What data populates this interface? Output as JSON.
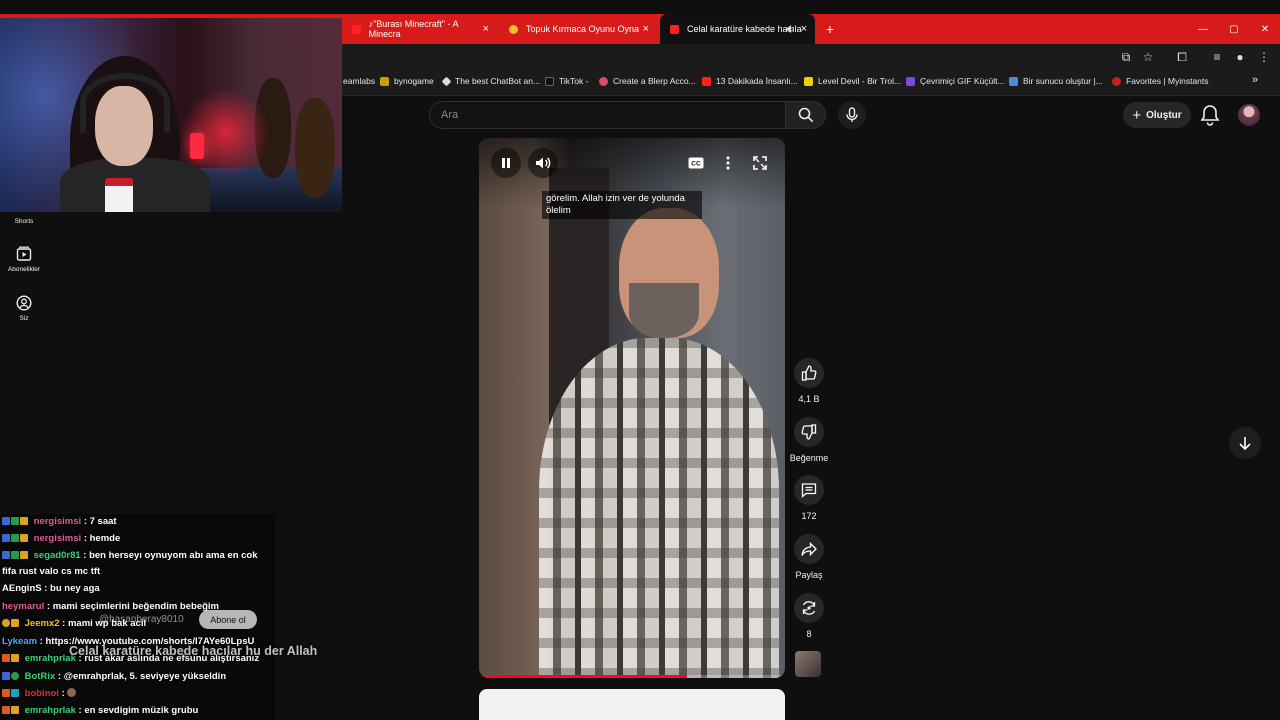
{
  "browser": {
    "tabs": [
      {
        "label": "♪\"Burası Minecraft\" - A Minecra",
        "close": "×"
      },
      {
        "label": "Topuk Kırmaca Oyunu Oyna",
        "close": "×"
      },
      {
        "label": "Celal karatüre kabede hacıla",
        "close": "×"
      }
    ],
    "new_tab": "+",
    "bookmarks": [
      "eamlabs",
      "bynogame",
      "The best ChatBot an...",
      "TikTok -",
      "Create a Blerp Acco...",
      "13 Dakikada İnsanlı...",
      "Level Devil - Bir Trol...",
      "Çevrimiçi GIF Küçült...",
      "Bir sunucu oluştur |...",
      "Favorites | Myinstants"
    ],
    "more_bookmarks": "»"
  },
  "youtube": {
    "search_placeholder": "Ara",
    "create_label": "Oluştur",
    "nav": [
      {
        "label": "Shorts"
      },
      {
        "label": "Abonelikler"
      },
      {
        "label": "Siz"
      }
    ],
    "player": {
      "caption_line1": "görelim. Allah izin ver de yolunda",
      "caption_line2": "ölelim",
      "progress": 0.68
    },
    "actions": {
      "like_count": "4,1 B",
      "dislike_label": "Beğenme",
      "comment_count": "172",
      "share_label": "Paylaş",
      "remix_count": "8"
    },
    "overlay": {
      "title": "Celal karatüre kabede hacılar hu der Allah",
      "handle": "@hasanberay8010",
      "subscribe": "Abone ol"
    }
  },
  "chat": [
    {
      "user": "nergisimsi",
      "text": ": 7 saat",
      "color": "#e05a9a"
    },
    {
      "user": "nergisimsi",
      "text": ": hemde",
      "color": "#e05a9a"
    },
    {
      "user": "segad0r81",
      "text": ": ben herseyı oynuyom abı ama en cok",
      "color": "#3fd07a"
    },
    {
      "user": "",
      "text": "fifa rust valo cs mc tft",
      "color": "#ffffff"
    },
    {
      "user": "AEnginS",
      "text": ": bu ney aga",
      "color": "#f2f2f2"
    },
    {
      "user": "heymarul",
      "text": ": mami seçimlerini beğendim bebeğim",
      "color": "#e05a9a"
    },
    {
      "user": "Jeemx2",
      "text": ": mami wp bak acil",
      "color": "#f0c020"
    },
    {
      "user": "Lykeam",
      "text": ": https://www.youtube.com/shorts/I7AYe60LpsU",
      "color": "#4aa8ff"
    },
    {
      "user": "emrahprlak",
      "text": ": rust akar aslında ne efsunu alıştırsanız",
      "color": "#3fd07a"
    },
    {
      "user": "BotRix",
      "text": ": @emrahprlak, 5. seviyeye yükseldin",
      "color": "#3fd07a"
    },
    {
      "user": "bobinoi",
      "text": ":",
      "color": "#e03030"
    },
    {
      "user": "emrahprlak",
      "text": ": en sevdigim müzik grubu",
      "color": "#3fd07a"
    }
  ],
  "colors": {
    "tabbar": "#d71b1b",
    "accent": "#ff0033",
    "background": "#0f0f0f"
  }
}
